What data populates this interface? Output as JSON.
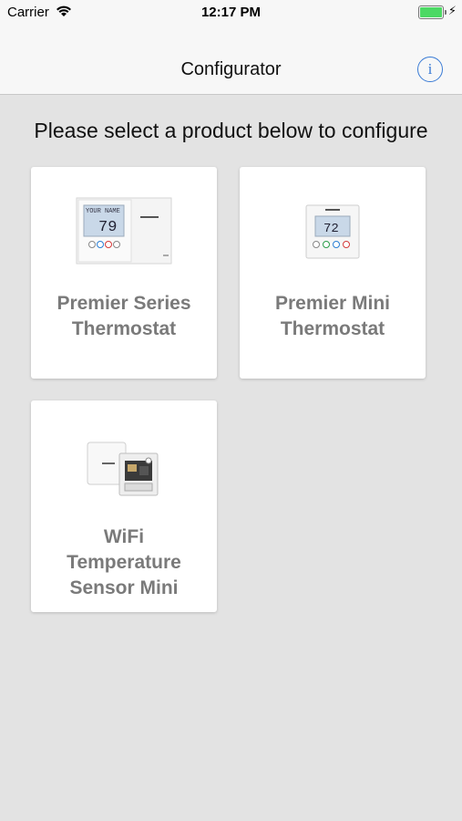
{
  "status_bar": {
    "carrier": "Carrier",
    "time": "12:17 PM",
    "wifi_icon": "wifi-icon",
    "battery_icon": "battery-icon",
    "charging_icon": "charging-bolt-icon"
  },
  "nav": {
    "title": "Configurator",
    "info_icon": "info-icon",
    "info_glyph": "i",
    "accent": "#3a7bd5"
  },
  "prompt": "Please select a product below to configure",
  "products": [
    {
      "label_line1": "Premier Series",
      "label_line2": "Thermostat",
      "display": "79",
      "display_top": "YOUR NAME",
      "image": "premier-series-thermostat-image"
    },
    {
      "label_line1": "Premier Mini",
      "label_line2": "Thermostat",
      "display": "72",
      "image": "premier-mini-thermostat-image"
    },
    {
      "label_line1": "WiFi",
      "label_line2": "Temperature",
      "label_line3": "Sensor Mini",
      "image": "wifi-temperature-sensor-mini-image"
    }
  ]
}
